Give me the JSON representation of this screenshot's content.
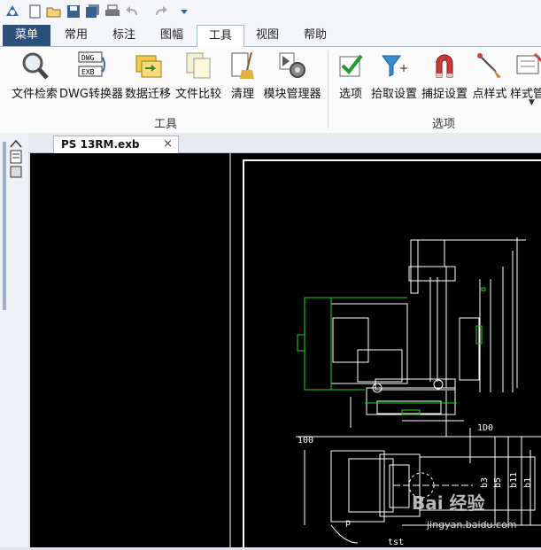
{
  "quick_access": {
    "icons": [
      "app-logo-icon",
      "new-file-icon",
      "open-folder-icon",
      "save-icon",
      "save-all-icon",
      "print-icon",
      "undo-icon",
      "redo-icon",
      "customize-dropdown-icon"
    ]
  },
  "tabs": [
    {
      "label": "菜单",
      "state": "menu"
    },
    {
      "label": "常用",
      "state": "normal"
    },
    {
      "label": "标注",
      "state": "normal"
    },
    {
      "label": "图幅",
      "state": "normal"
    },
    {
      "label": "工具",
      "state": "active"
    },
    {
      "label": "视图",
      "state": "normal"
    },
    {
      "label": "帮助",
      "state": "normal"
    }
  ],
  "ribbon": {
    "groups": [
      {
        "label": "工具",
        "buttons": [
          {
            "label": "文件检索",
            "icon": "magnifier-icon"
          },
          {
            "label": "DWG转换器",
            "icon": "dwg-exb-converter-icon"
          },
          {
            "label": "数据迁移",
            "icon": "data-migration-icon"
          },
          {
            "label": "文件比较",
            "icon": "file-compare-icon"
          },
          {
            "label": "清理",
            "icon": "clean-broom-icon"
          },
          {
            "label": "模块管理器",
            "icon": "module-manager-gear-icon"
          }
        ]
      },
      {
        "label": "选项",
        "buttons": [
          {
            "label": "选项",
            "icon": "checkmark-icon"
          },
          {
            "label": "拾取设置",
            "icon": "filter-pick-icon"
          },
          {
            "label": "捕捉设置",
            "icon": "magnet-snap-icon"
          },
          {
            "label": "点样式",
            "icon": "point-style-icon"
          },
          {
            "label": "样式管",
            "icon": "style-manager-icon"
          }
        ]
      }
    ]
  },
  "document": {
    "tab_title": "PS 13RM.exb",
    "close_glyph": "×"
  },
  "drawing": {
    "labels": {
      "dim_100": "100",
      "dim_1d0": "1D0",
      "dim_b3": "b3",
      "dim_b5": "b5",
      "dim_b11": "b11",
      "dim_b1": "b1",
      "dim_tst": "tst",
      "dim_p": "p"
    }
  },
  "watermark": {
    "brand": "Bai 经验",
    "url": "jingyan.baidu.com"
  },
  "colors": {
    "menu_tab": "#2d4f7c",
    "canvas": "#000000",
    "cad_white": "#ffffff",
    "cad_green": "#1fd61f",
    "accent": "#3a6ea5"
  }
}
